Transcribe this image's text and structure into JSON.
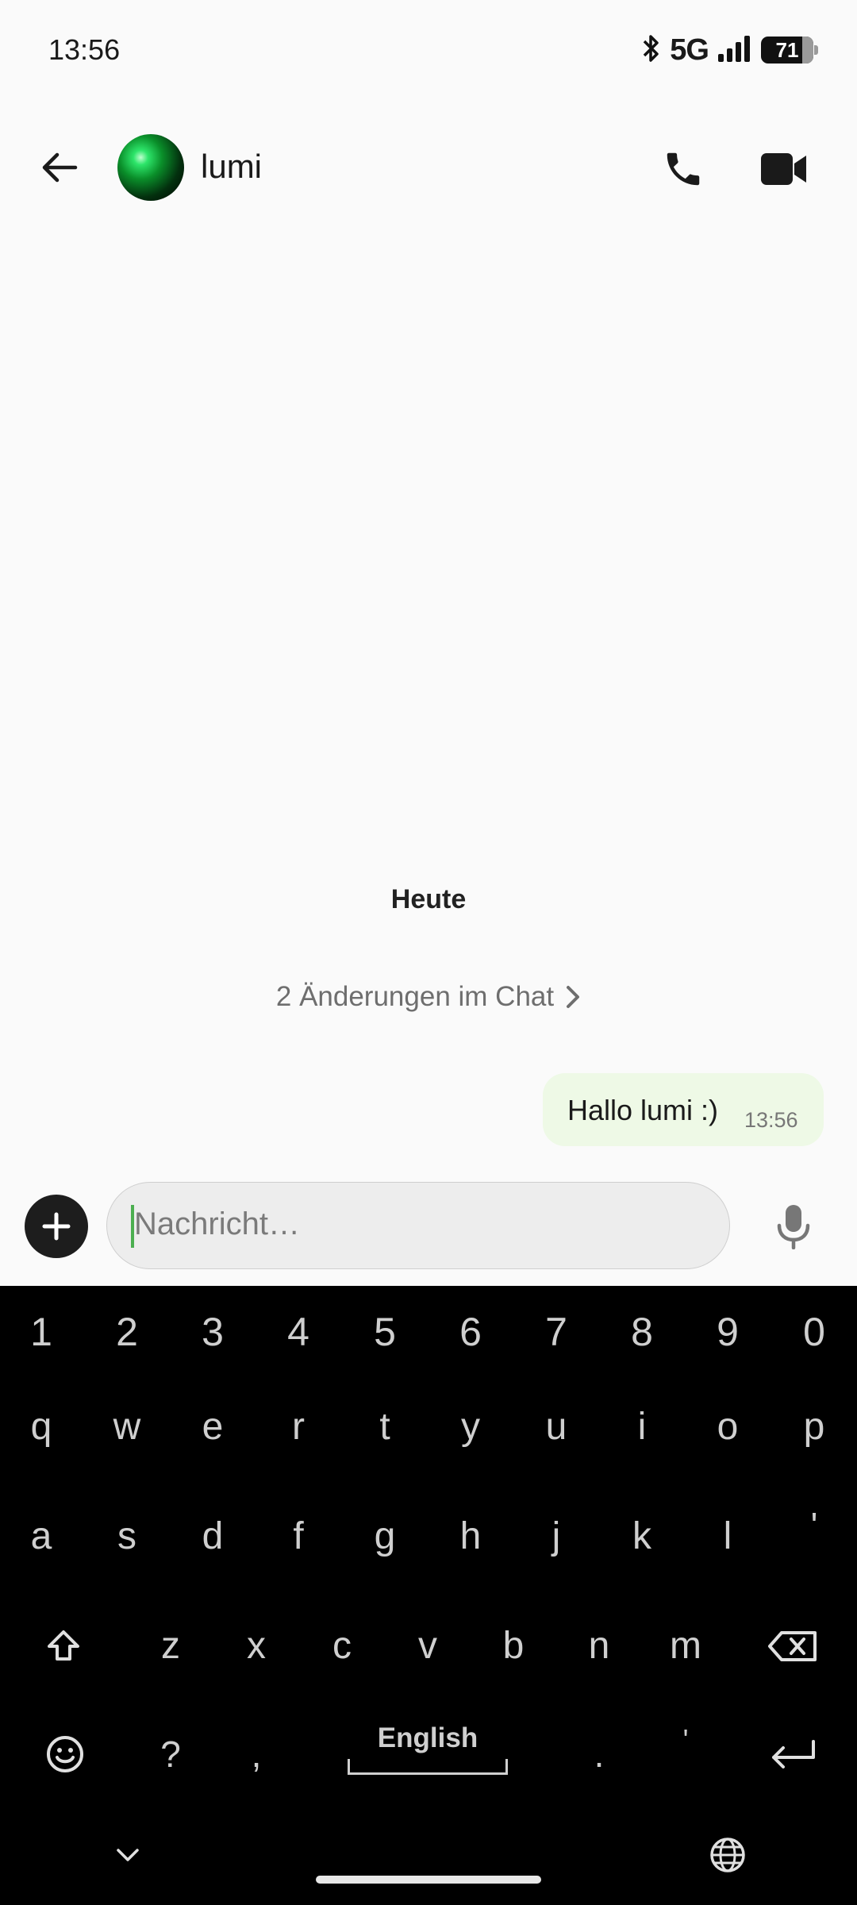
{
  "status_bar": {
    "time": "13:56",
    "network": "5G",
    "battery": "71"
  },
  "header": {
    "contact_name": "lumi",
    "icons": [
      "back-arrow-icon",
      "phone-icon",
      "video-camera-icon"
    ]
  },
  "chat": {
    "date_divider": "Heute",
    "changes_link": "2 Änderungen im Chat",
    "messages": [
      {
        "text": "Hallo lumi :)",
        "time": "13:56",
        "direction": "outgoing"
      }
    ]
  },
  "composer": {
    "placeholder": "Nachricht…"
  },
  "keyboard": {
    "row_numbers": [
      "1",
      "2",
      "3",
      "4",
      "5",
      "6",
      "7",
      "8",
      "9",
      "0"
    ],
    "row_q": [
      "q",
      "w",
      "e",
      "r",
      "t",
      "y",
      "u",
      "i",
      "o",
      "p"
    ],
    "row_a": [
      "a",
      "s",
      "d",
      "f",
      "g",
      "h",
      "j",
      "k",
      "l",
      "'"
    ],
    "row_z": [
      "z",
      "x",
      "c",
      "v",
      "b",
      "n",
      "m"
    ],
    "row_bottom": [
      "?",
      ",",
      ".",
      "'"
    ],
    "space_label": "English"
  },
  "colors": {
    "background": "#fafafa",
    "bubble_outgoing": "#eef9e6",
    "caret": "#4caf50",
    "keyboard_bg": "#000000"
  }
}
